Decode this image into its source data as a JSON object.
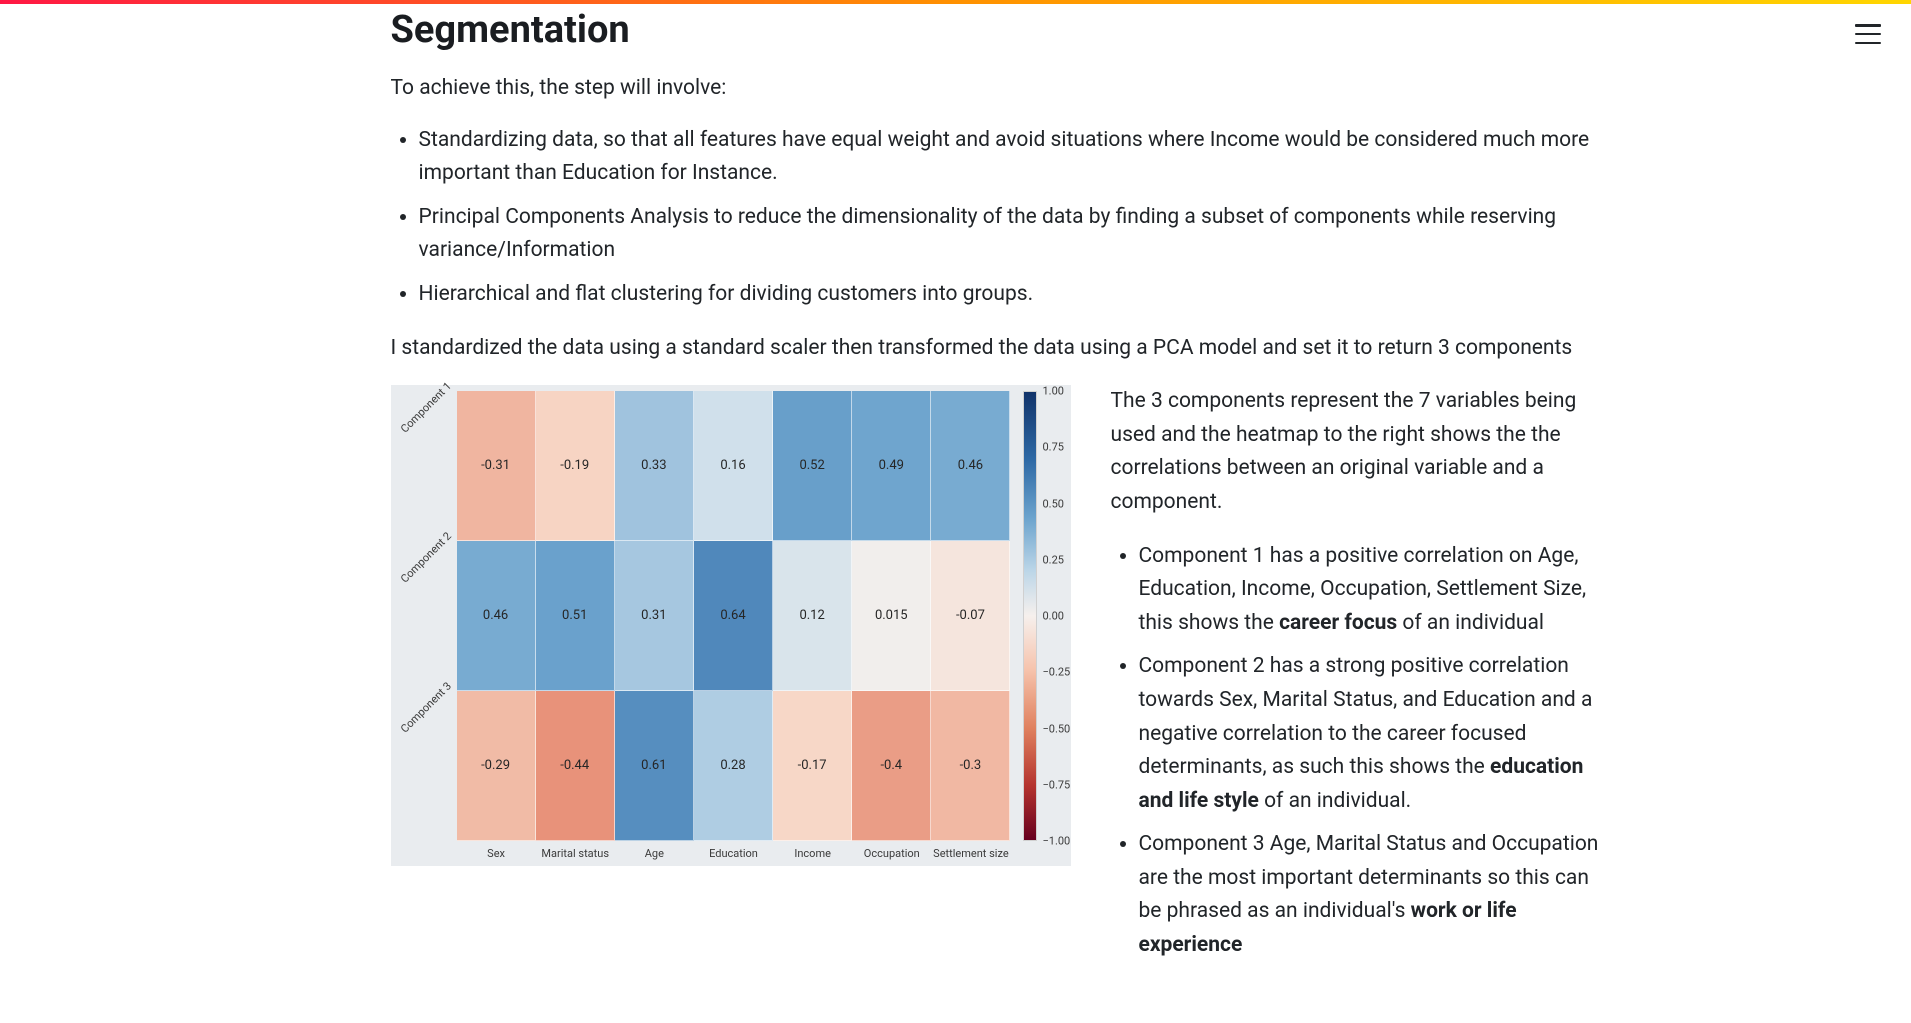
{
  "title": "Segmentation",
  "intro": "To achieve this, the step will involve:",
  "steps": [
    "Standardizing data, so that all features have equal weight and avoid situations where Income would be considered much more important than Education for Instance.",
    "Principal Components Analysis to reduce the dimensionality of the data by finding a subset of components while reserving variance/Information",
    "Hierarchical and flat clustering for dividing customers into groups."
  ],
  "scaler_text": "I standardized the data using a standard scaler then transformed the data using a PCA model and set it to return 3 components",
  "right": {
    "intro": "The 3 components represent the 7 variables being used and the heatmap to the right shows the the correlations between an original variable and a component.",
    "items": [
      {
        "pre": "Component 1 has a positive correlation on Age, Education, Income, Occupation, Settlement Size, this shows the ",
        "bold": "career focus",
        "post": " of an individual"
      },
      {
        "pre": "Component 2 has a strong positive correlation towards Sex, Marital Status, and Education and a negative correlation to the career focused determinants, as such this shows the ",
        "bold": "education and life style",
        "post": " of an individual."
      },
      {
        "pre": "Component 3 Age, Marital Status and Occupation are the most important determinants so this can be phrased as an individual's ",
        "bold": "work or life experience",
        "post": ""
      }
    ]
  },
  "chart_data": {
    "type": "heatmap",
    "title": "",
    "y_labels": [
      "Component 1",
      "Component 2",
      "Component 3"
    ],
    "x_labels": [
      "Sex",
      "Marital status",
      "Age",
      "Education",
      "Income",
      "Occupation",
      "Settlement size"
    ],
    "values": [
      [
        -0.31,
        -0.19,
        0.33,
        0.16,
        0.52,
        0.49,
        0.46
      ],
      [
        0.46,
        0.51,
        0.31,
        0.64,
        0.12,
        0.015,
        -0.07
      ],
      [
        -0.29,
        -0.44,
        0.61,
        0.28,
        -0.17,
        -0.4,
        -0.3
      ]
    ],
    "cell_labels": [
      [
        "-0.31",
        "-0.19",
        "0.33",
        "0.16",
        "0.52",
        "0.49",
        "0.46"
      ],
      [
        "0.46",
        "0.51",
        "0.31",
        "0.64",
        "0.12",
        "0.015",
        "-0.07"
      ],
      [
        "-0.29",
        "-0.44",
        "0.61",
        "0.28",
        "-0.17",
        "-0.4",
        "-0.3"
      ]
    ],
    "vmin": -1.0,
    "vmax": 1.0,
    "colorbar_ticks": [
      {
        "v": 1.0,
        "label": "1.00"
      },
      {
        "v": 0.75,
        "label": "0.75"
      },
      {
        "v": 0.5,
        "label": "0.50"
      },
      {
        "v": 0.25,
        "label": "0.25"
      },
      {
        "v": 0.0,
        "label": "0.00"
      },
      {
        "v": -0.25,
        "label": "−0.25"
      },
      {
        "v": -0.5,
        "label": "−0.50"
      },
      {
        "v": -0.75,
        "label": "−0.75"
      },
      {
        "v": -1.0,
        "label": "−1.00"
      }
    ],
    "cmap_stops": [
      {
        "t": 0.0,
        "c": "#67001f"
      },
      {
        "t": 0.1,
        "c": "#b2182b"
      },
      {
        "t": 0.25,
        "c": "#e48268"
      },
      {
        "t": 0.4,
        "c": "#f7d3c1"
      },
      {
        "t": 0.5,
        "c": "#f4efec"
      },
      {
        "t": 0.6,
        "c": "#c7dceb"
      },
      {
        "t": 0.75,
        "c": "#6ca3cd"
      },
      {
        "t": 0.9,
        "c": "#2f6aa6"
      },
      {
        "t": 1.0,
        "c": "#11336a"
      }
    ]
  }
}
